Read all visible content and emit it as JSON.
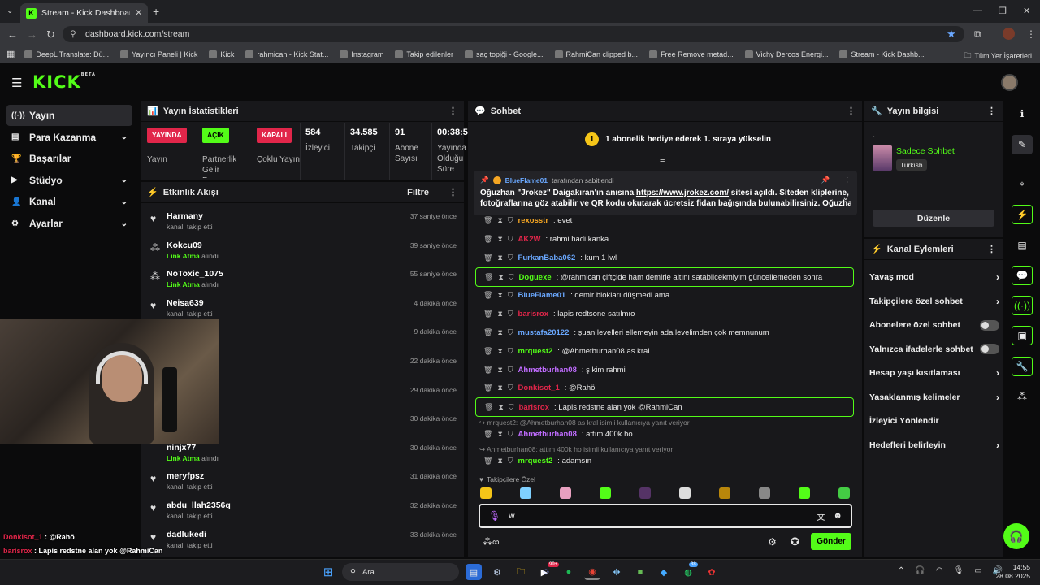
{
  "browser": {
    "tab_title": "Stream - Kick Dashboard",
    "url": "dashboard.kick.com/stream",
    "bookmarks": [
      "DeepL Translate: Dü...",
      "Yayıncı Paneli | Kick",
      "Kick",
      "rahmican - Kick Stat...",
      "Instagram",
      "Takip edilenler",
      "saç topiği - Google...",
      "RahmiCan clipped b...",
      "Free Remove metad...",
      "Vichy Dercos Energi...",
      "Stream - Kick Dashb..."
    ],
    "all_bookmarks": "Tüm Yer İşaretleri"
  },
  "logo": "KICK",
  "logo_sup": "BETA",
  "sidebar": {
    "items": [
      {
        "label": "Yayın",
        "icon": "((·))"
      },
      {
        "label": "Para Kazanma",
        "icon": "▤"
      },
      {
        "label": "Başarılar",
        "icon": "🏆"
      },
      {
        "label": "Stüdyo",
        "icon": "▶"
      },
      {
        "label": "Kanal",
        "icon": "👤"
      },
      {
        "label": "Ayarlar",
        "icon": "⚙"
      }
    ]
  },
  "stats": {
    "title": "Yayın İstatistikleri",
    "items": [
      {
        "badge": "YAYINDA",
        "label": "Yayın",
        "color": "#e1264a"
      },
      {
        "badge": "AÇIK",
        "label": "Partnerlik Gelir Programı",
        "color": "#53fc18"
      },
      {
        "badge": "KAPALI",
        "label": "Çoklu Yayın",
        "color": "#e1264a"
      },
      {
        "value": "584",
        "label": "İzleyici"
      },
      {
        "value": "34.585",
        "label": "Takipçi"
      },
      {
        "value": "91",
        "label": "Abone Sayısı"
      },
      {
        "value": "00:38:5",
        "label": "Yayında Olduğu Süre"
      }
    ]
  },
  "activity": {
    "title": "Etkinlik Akışı",
    "filter": "Filtre",
    "items": [
      {
        "name": "Harmany",
        "desc": "kanalı takip etti",
        "time": "37 saniye önce",
        "icon": "♥"
      },
      {
        "name": "Kokcu09",
        "desc_bold": "Link Atma",
        "desc": " alındı",
        "time": "39 saniye önce",
        "icon": "⁂"
      },
      {
        "name": "NoToxic_1075",
        "desc_bold": "Link Atma",
        "desc": " alındı",
        "time": "55 saniye önce",
        "icon": "⁂"
      },
      {
        "name": "Neisa639",
        "desc": "kanalı takip etti",
        "time": "4 dakika önce",
        "icon": "♥"
      },
      {
        "name": "",
        "desc": "",
        "time": "9 dakika önce",
        "icon": ""
      },
      {
        "name": "",
        "desc": "",
        "time": "22 dakika önce",
        "icon": ""
      },
      {
        "name": "L99",
        "desc": "",
        "time": "29 dakika önce",
        "icon": ""
      },
      {
        "name": "",
        "desc": "",
        "time": "30 dakika önce",
        "icon": ""
      },
      {
        "name": "ninjx77",
        "desc_bold": "Link Atma",
        "desc": " alındı",
        "time": "30 dakika önce",
        "icon": ""
      },
      {
        "name": "meryfpsz",
        "desc": "kanalı takip etti",
        "time": "31 dakika önce",
        "icon": "♥"
      },
      {
        "name": "abdu_llah2356q",
        "desc": "kanalı takip etti",
        "time": "32 dakika önce",
        "icon": "♥"
      },
      {
        "name": "dadlukedi",
        "desc": "kanalı takip etti",
        "time": "33 dakika önce",
        "icon": "♥"
      }
    ]
  },
  "chat": {
    "title": "Sohbet",
    "gift_banner": "1 abonelik hediye ederek 1. sıraya yükselin",
    "gift_rank": "1",
    "pinned_by_user": "BlueFlame01",
    "pinned_by_suffix": " tarafından sabitlendi",
    "pinned_text_1": "Oğuzhan \"Jrokez\" Daigakıran'ın anısına ",
    "pinned_link": "https://www.jrokez.com/",
    "pinned_text_2": " sitesi açıldı. Siteden kliplerine,",
    "pinned_text_line2": "fotoğraflarına göz atabilir ve QR kodu okutarak ücretsiz fidan bağışında bulunabilirsiniz. Oğuzha...",
    "messages": [
      {
        "user": "rexosstr",
        "text": ": evet",
        "color": "#f5a623"
      },
      {
        "user": "AK2W",
        "text": ": rahmi hadi kanka",
        "color": "#e1264a"
      },
      {
        "user": "FurkanBaba062",
        "text": ": kum 1 lwl",
        "color": "#6aa8ff"
      },
      {
        "user": "Doguexe",
        "text": ": @rahmican çiftçide ham demirle altını satabilcekmiyim güncellemeden sonra",
        "color": "#53fc18"
      },
      {
        "user": "BlueFlame01",
        "text": ": demir blokları düşmedi ama",
        "color": "#6aa8ff"
      },
      {
        "user": "barisrox",
        "text": ": lapis redtsone satılmıo",
        "color": "#e1264a"
      },
      {
        "user": "mustafa20122",
        "text": ": şuan levelleri ellemeyin ada levelimden çok memnunum",
        "color": "#6aa8ff"
      },
      {
        "user": "mrquest2",
        "text": ": @Ahmetburhan08 as kral",
        "color": "#53fc18"
      },
      {
        "user": "Ahmetburhan08",
        "text": ": ş kim rahmi",
        "color": "#c06cff"
      },
      {
        "user": "Donkisot_1",
        "text": ": @Rahö",
        "color": "#e1264a"
      },
      {
        "user": "barisrox",
        "text": ": Lapis redstne alan yok @RahmiCan",
        "color": "#e1264a"
      }
    ],
    "reply1": "mrquest2: @Ahmetburhan08 as kral isimli kullanıcıya yanıt veriyor",
    "msg_reply1": {
      "user": "Ahmetburhan08",
      "text": ": attım 400k ho",
      "color": "#c06cff"
    },
    "reply2": "Ahmetburhan08: attım 400k ho isimli kullanıcıya yanıt veriyor",
    "msg_reply2": {
      "user": "mrquest2",
      "text": ": adamsın",
      "color": "#53fc18"
    },
    "followers_only": "Takipçilere Özel",
    "input_value": "w",
    "send_label": "Gönder"
  },
  "stream_info": {
    "title": "Yayın bilgisi",
    "dot": ".",
    "category": "Sadece Sohbet",
    "language": "Turkish",
    "edit_label": "Düzenle"
  },
  "channel_actions": {
    "title": "Kanal Eylemleri",
    "items": [
      {
        "label": "Yavaş mod",
        "control": "chevron"
      },
      {
        "label": "Takipçilere özel sohbet",
        "control": "chevron"
      },
      {
        "label": "Abonelere özel sohbet",
        "control": "toggle"
      },
      {
        "label": "Yalnızca ifadelerle sohbet",
        "control": "toggle"
      },
      {
        "label": "Hesap yaşı kısıtlaması",
        "control": "chevron"
      },
      {
        "label": "Yasaklanmış kelimeler",
        "control": "chevron"
      },
      {
        "label": "İzleyici Yönlendir",
        "control": "none"
      },
      {
        "label": "Hedefleri belirleyin",
        "control": "chevron"
      }
    ]
  },
  "overlay_chat": [
    {
      "user": "Donkisot_1",
      "text": " : @Rahö",
      "color": "#e1264a"
    },
    {
      "user": "barisrox",
      "text": " : Lapis redstne alan yok @RahmiCan",
      "color": "#e1264a"
    },
    {
      "user": "Ahmetburhan08",
      "text": " : attım 400k ho",
      "color": "#c06cff"
    },
    {
      "user": "mrquest2",
      "text": " : adamsın",
      "color": "#53fc18"
    }
  ],
  "taskbar": {
    "search": "Ara",
    "time": "14:55",
    "date": "28.08.2025",
    "badge1": "99+",
    "badge2": "38"
  }
}
